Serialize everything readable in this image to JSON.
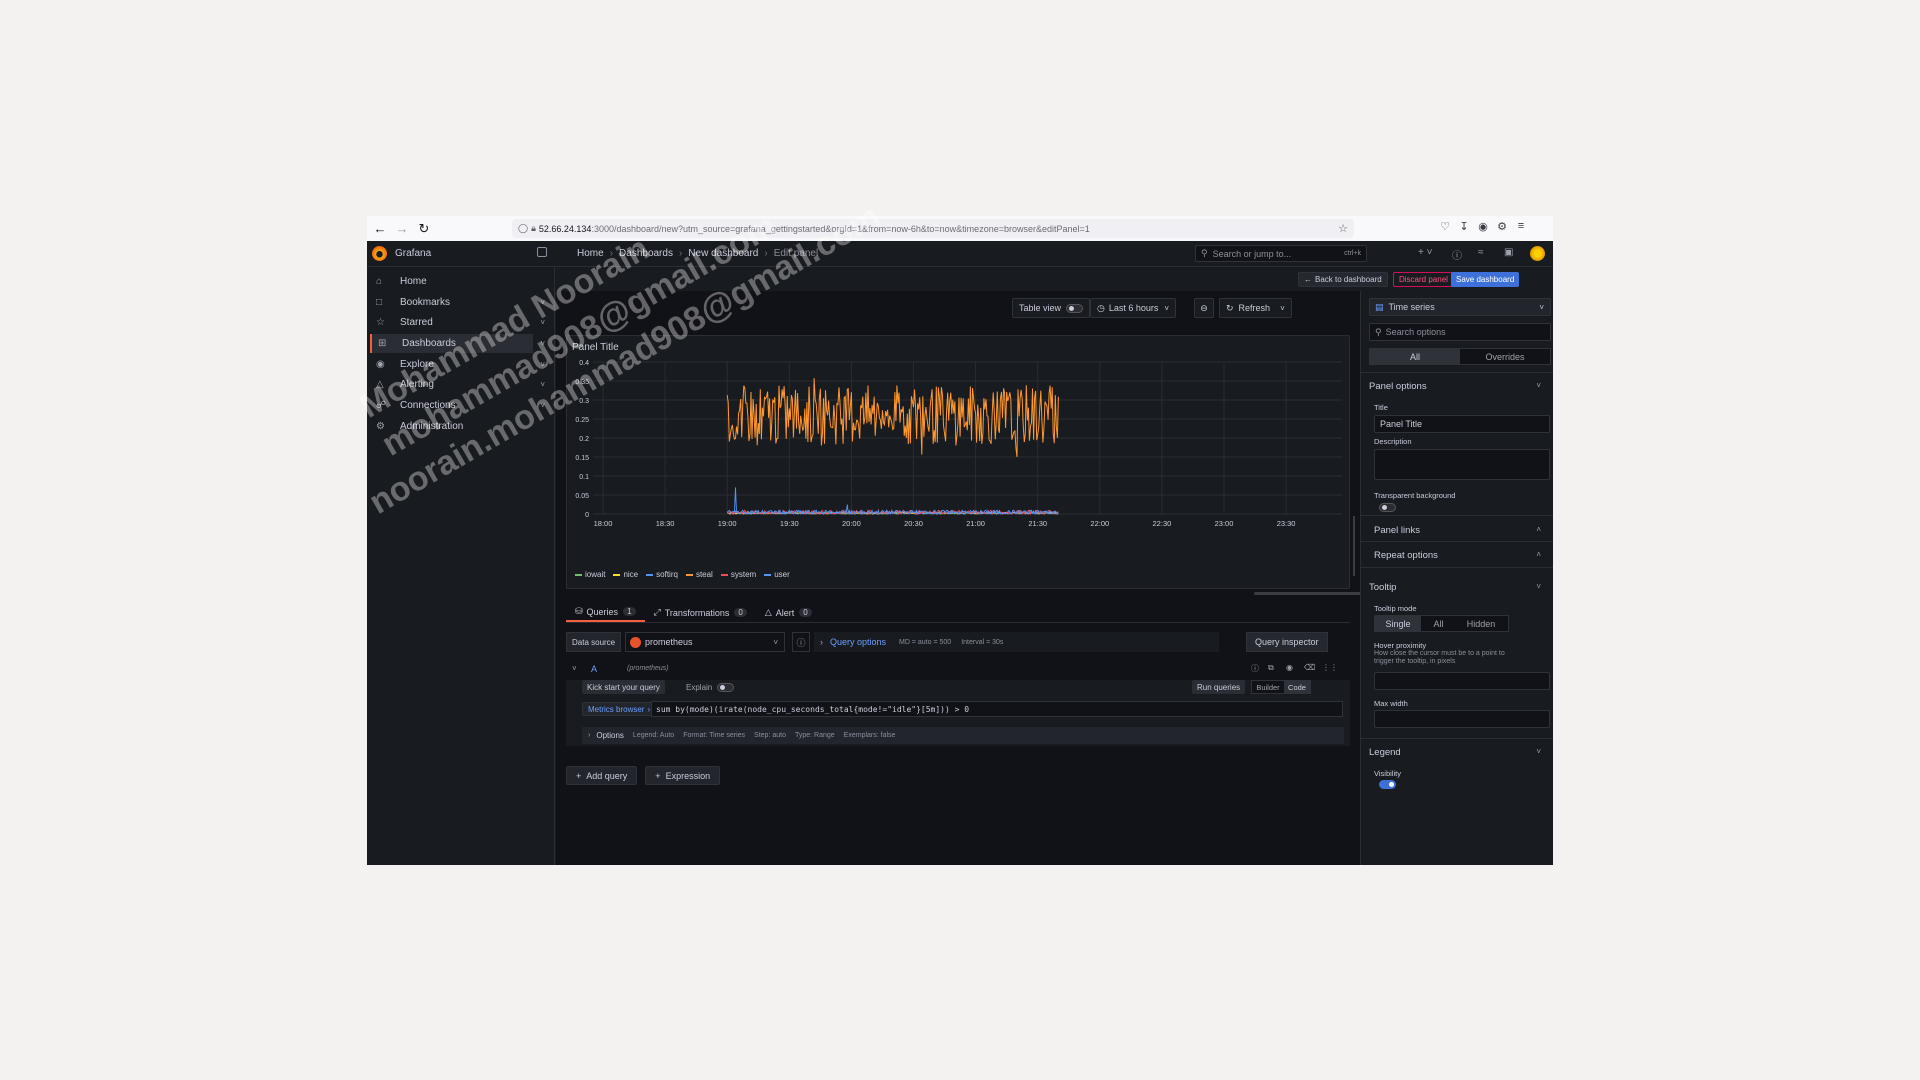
{
  "browser": {
    "url_host": "52.66.24.134",
    "url_rest": ":3000/dashboard/new?utm_source=grafana_gettingstarted&orgId=1&from=now-6h&to=now&timezone=browser&editPanel=1"
  },
  "topbar": {
    "brand": "Grafana",
    "breadcrumb": [
      "Home",
      "Dashboards",
      "New dashboard",
      "Edit panel"
    ],
    "search_placeholder": "Search or jump to...",
    "search_shortcut": "ctrl+k"
  },
  "sidebar": {
    "items": [
      {
        "label": "Home",
        "icon": "home-icon"
      },
      {
        "label": "Bookmarks",
        "icon": "bookmark-icon"
      },
      {
        "label": "Starred",
        "icon": "star-icon"
      },
      {
        "label": "Dashboards",
        "icon": "dashboards-icon"
      },
      {
        "label": "Explore",
        "icon": "compass-icon"
      },
      {
        "label": "Alerting",
        "icon": "bell-icon"
      },
      {
        "label": "Connections",
        "icon": "connections-icon"
      },
      {
        "label": "Administration",
        "icon": "gear-icon"
      }
    ]
  },
  "actions": {
    "back": "Back to dashboard",
    "discard": "Discard panel",
    "save": "Save dashboard"
  },
  "controls": {
    "table_view": "Table view",
    "time_range": "Last 6 hours",
    "refresh": "Refresh"
  },
  "panel": {
    "title": "Panel Title"
  },
  "chart_data": {
    "type": "line",
    "title": "Panel Title",
    "x_ticks": [
      "18:00",
      "18:30",
      "19:00",
      "19:30",
      "20:00",
      "20:30",
      "21:00",
      "21:30",
      "22:00",
      "22:30",
      "23:00",
      "23:30"
    ],
    "y_ticks": [
      0,
      0.05,
      0.1,
      0.15,
      0.2,
      0.25,
      0.3,
      0.35,
      0.4
    ],
    "ylim": [
      0,
      0.4
    ],
    "x_range": [
      "19:00",
      "21:40"
    ],
    "grid": true,
    "legend_position": "bottom-left",
    "series": [
      {
        "name": "iowait",
        "color": "#73bf69",
        "approx_range": [
          0,
          0.005
        ]
      },
      {
        "name": "nice",
        "color": "#fade2a",
        "approx_range": [
          0,
          0.005
        ]
      },
      {
        "name": "softirq",
        "color": "#5794f2",
        "approx_range": [
          0,
          0.07
        ]
      },
      {
        "name": "steal",
        "color": "#ff9830",
        "approx_range": [
          0.15,
          0.36
        ]
      },
      {
        "name": "system",
        "color": "#f2495c",
        "approx_range": [
          0,
          0.01
        ]
      },
      {
        "name": "user",
        "color": "#5794f2",
        "approx_range": [
          0,
          0.01
        ]
      }
    ]
  },
  "tabs": [
    {
      "label": "Queries",
      "count": "1",
      "icon": "database-icon"
    },
    {
      "label": "Transformations",
      "count": "0",
      "icon": "transform-icon"
    },
    {
      "label": "Alert",
      "count": "0",
      "icon": "bell-icon"
    }
  ],
  "query": {
    "data_source_label": "Data source",
    "data_source": "prometheus",
    "query_options": "Query options",
    "md": "MD = auto = 500",
    "interval": "Interval = 30s",
    "inspector": "Query inspector",
    "ref": "A",
    "ref_source": "(prometheus)",
    "kick_start": "Kick start your query",
    "explain": "Explain",
    "run": "Run queries",
    "builder": "Builder",
    "code": "Code",
    "metrics_browser": "Metrics browser",
    "expression": "sum by(mode)(irate(node_cpu_seconds_total{mode!=\"idle\"}[5m])) > 0",
    "options_label": "Options",
    "options_items": [
      "Legend: Auto",
      "Format: Time series",
      "Step: auto",
      "Type: Range",
      "Exemplars: false"
    ],
    "add_query": "Add query",
    "expression_btn": "Expression"
  },
  "options_pane": {
    "viz": "Time series",
    "search_placeholder": "Search options",
    "tab_all": "All",
    "tab_overrides": "Overrides",
    "panel_options": "Panel options",
    "title_label": "Title",
    "title_value": "Panel Title",
    "description_label": "Description",
    "transparent_label": "Transparent background",
    "panel_links": "Panel links",
    "repeat_options": "Repeat options",
    "tooltip": "Tooltip",
    "tooltip_mode": "Tooltip mode",
    "modes": [
      "Single",
      "All",
      "Hidden"
    ],
    "hover_proximity": "Hover proximity",
    "hover_hint": "How close the cursor must be to a point to trigger the tooltip, in pixels",
    "max_width": "Max width",
    "legend": "Legend",
    "visibility": "Visibility"
  },
  "watermark": [
    "Mohammad Noorain",
    "mohammad908@gmail.com",
    "noorain.mohammad908@gmail.com"
  ]
}
